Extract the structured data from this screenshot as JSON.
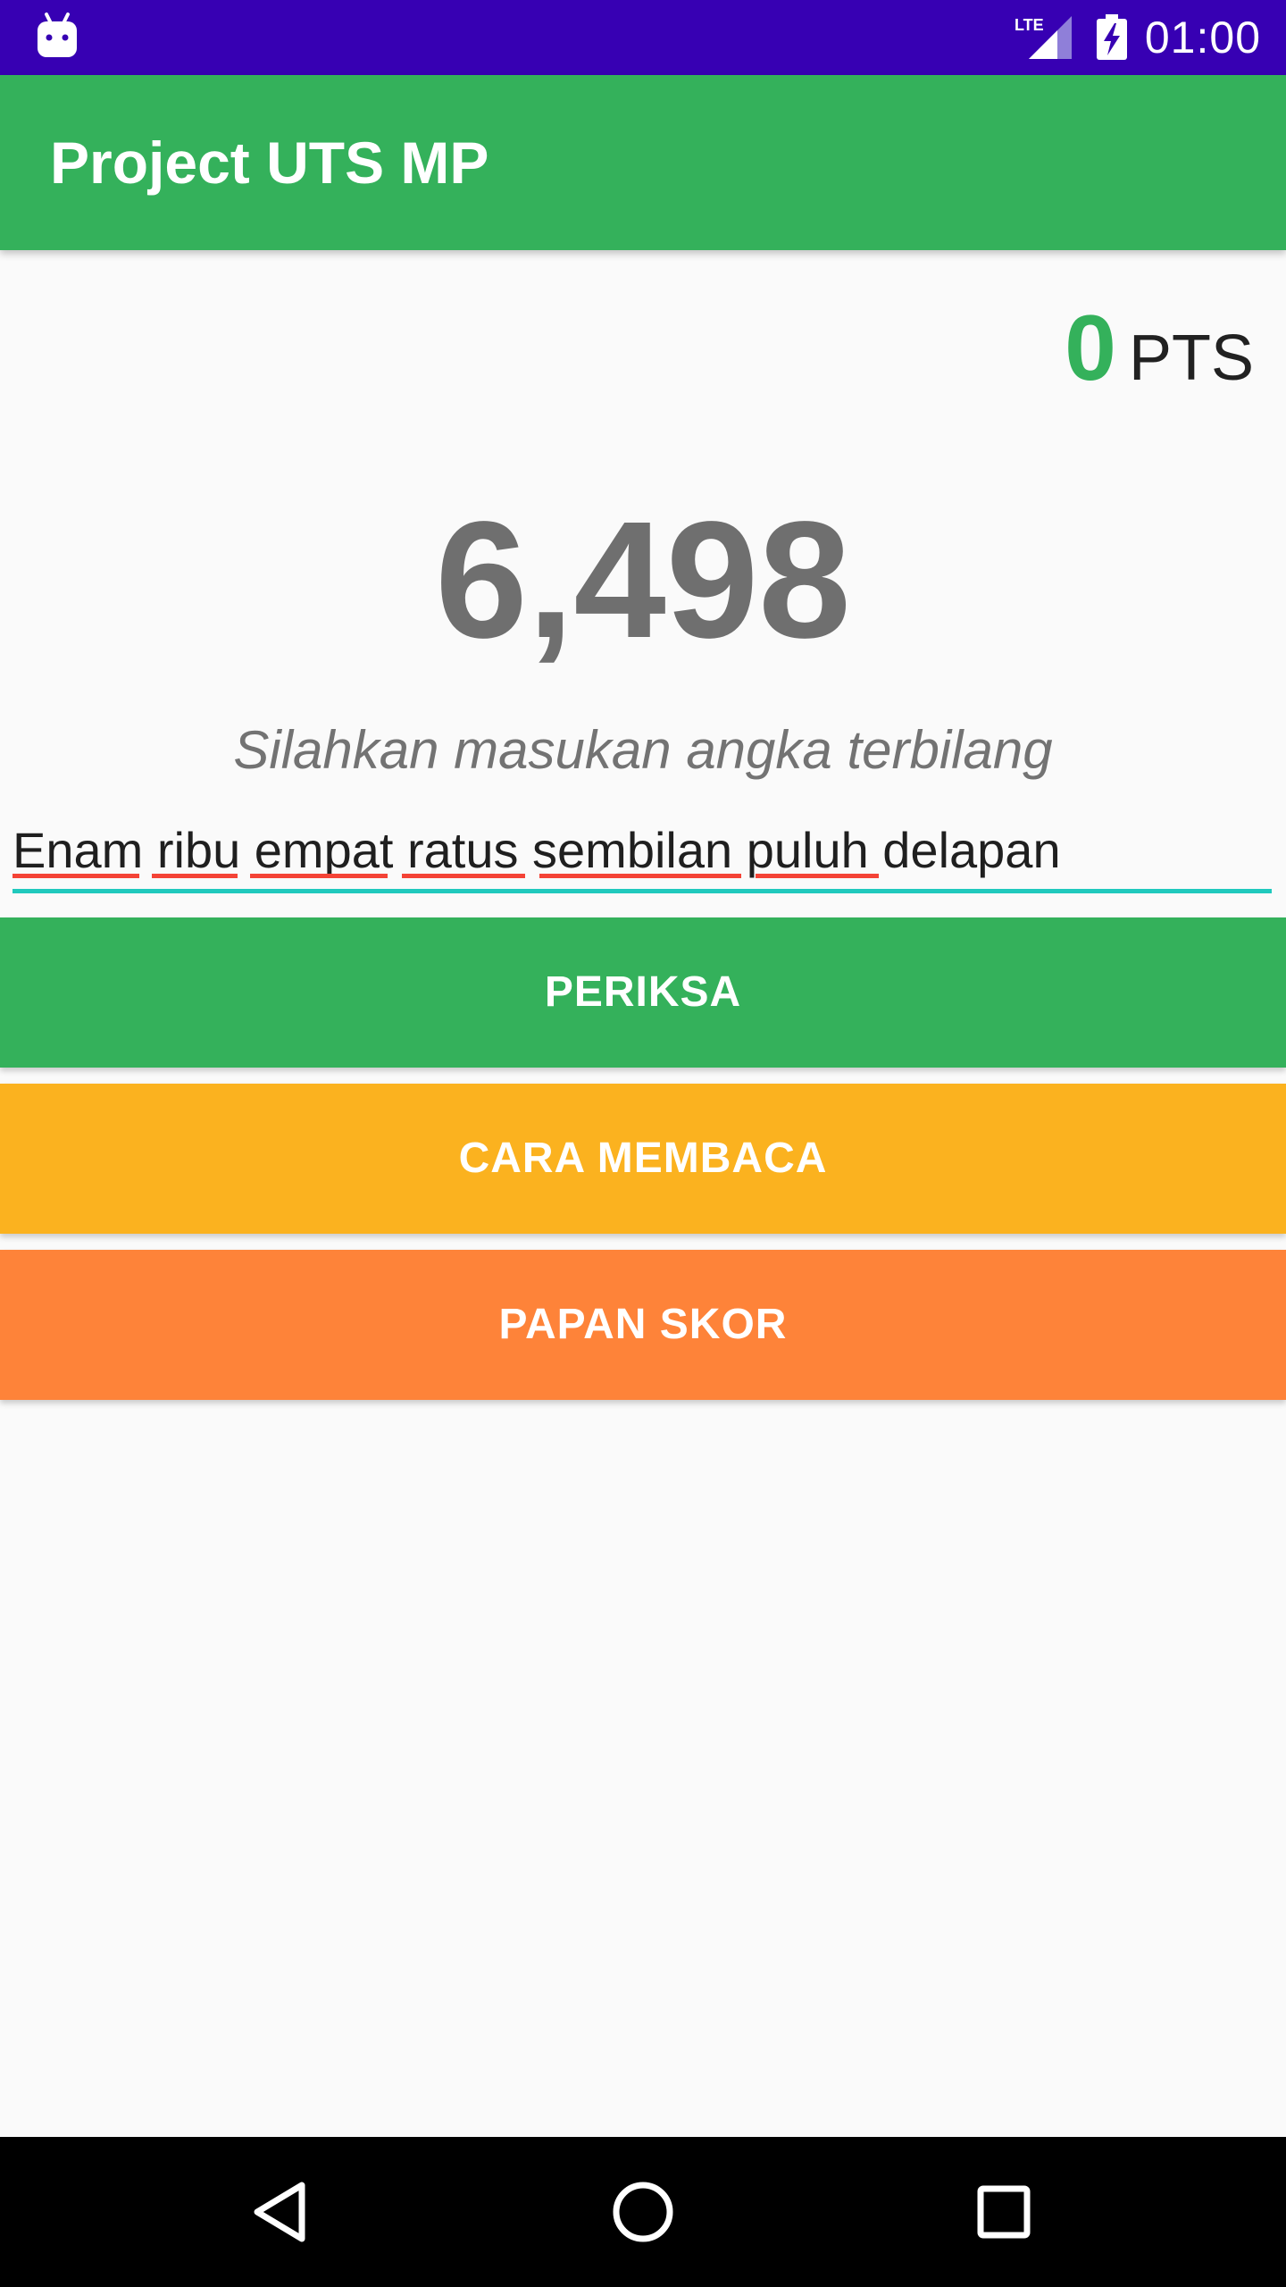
{
  "status_bar": {
    "time": "01:00",
    "network": "LTE",
    "icons": [
      "android-icon",
      "lte-signal-icon",
      "battery-charging-icon"
    ]
  },
  "app_bar": {
    "title": "Project UTS MP"
  },
  "score": {
    "points": "0",
    "label": "PTS"
  },
  "question": {
    "number": "6,498",
    "instruction": "Silahkan masukan angka terbilang"
  },
  "answer": {
    "value": "Enam ribu empat ratus sembilan puluh delapan"
  },
  "buttons": {
    "check": "PERIKSA",
    "how_to_read": "CARA MEMBACA",
    "scoreboard": "PAPAN SKOR"
  },
  "nav_bar": {
    "icons": [
      "back-icon",
      "home-icon",
      "recent-apps-icon"
    ]
  },
  "colors": {
    "status_bar": "#3700b3",
    "primary": "#34b15b",
    "yellow_button": "#fbb21f",
    "orange_button": "#fe8339",
    "accent_underline": "#20c9bd",
    "number_text": "#6f6f6f"
  }
}
